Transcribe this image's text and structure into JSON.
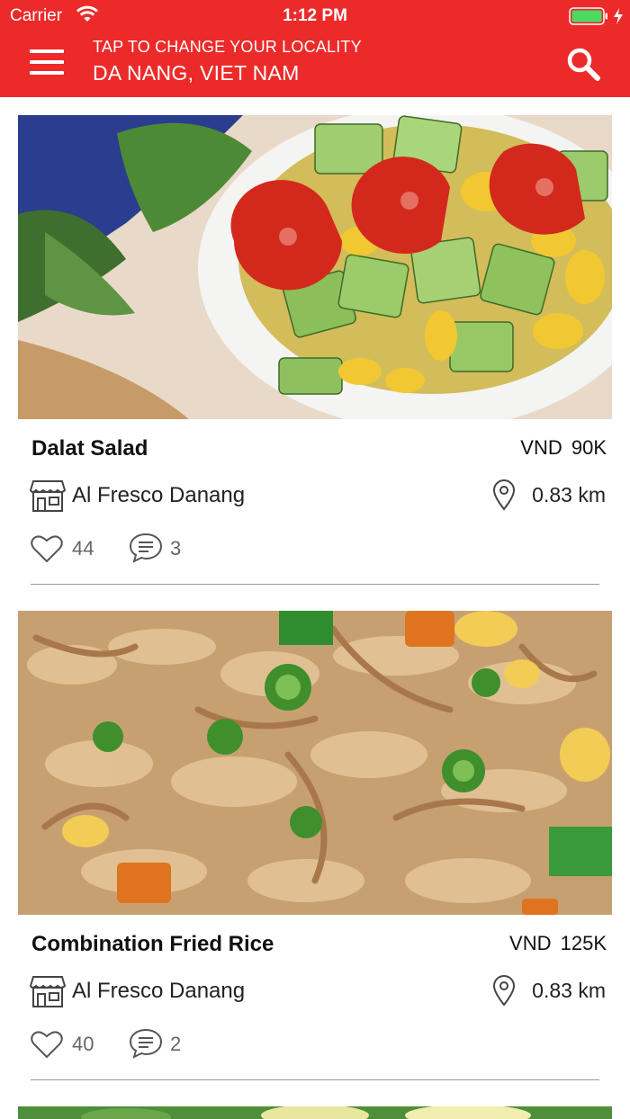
{
  "status_bar": {
    "carrier": "Carrier",
    "time": "1:12 PM"
  },
  "header": {
    "locality_hint": "TAP TO CHANGE YOUR LOCALITY",
    "locality": "DA NANG, VIET NAM"
  },
  "colors": {
    "brand": "#ec2a2a",
    "text": "#111111",
    "muted": "#666666",
    "divider": "#9a9a9a"
  },
  "dishes": [
    {
      "name": "Dalat Salad",
      "price": "VND 90K",
      "restaurant": "Al Fresco Danang",
      "distance": "0.83 km",
      "likes": "44",
      "comments": "3",
      "image": "salad-photo"
    },
    {
      "name": "Combination Fried Rice",
      "price": "VND 125K",
      "restaurant": "Al Fresco Danang",
      "distance": "0.83 km",
      "likes": "40",
      "comments": "2",
      "image": "fried-rice-photo"
    }
  ]
}
